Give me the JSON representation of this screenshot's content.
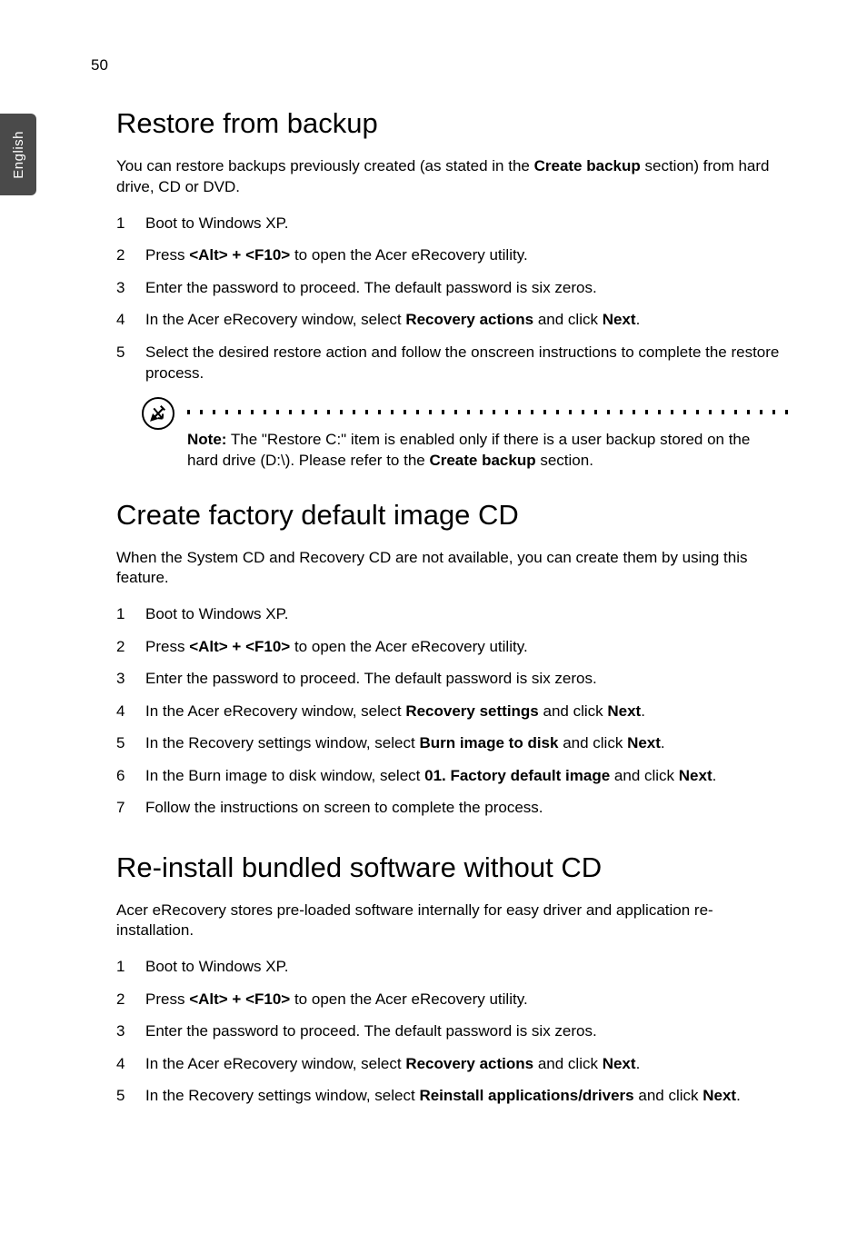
{
  "side_tab": "English",
  "page_number": "50",
  "sections": [
    {
      "title": "Restore from backup",
      "intro_parts": [
        "You can restore backups previously created (as stated in the ",
        "Create backup",
        " section) from hard drive, CD or DVD."
      ],
      "items": [
        {
          "parts": [
            "Boot to Windows XP."
          ]
        },
        {
          "parts": [
            "Press ",
            "<Alt> + <F10>",
            " to open the Acer eRecovery utility."
          ]
        },
        {
          "parts": [
            "Enter the password to proceed. The default password is six zeros."
          ]
        },
        {
          "parts": [
            "In the Acer eRecovery window, select ",
            "Recovery actions",
            " and click ",
            "Next",
            "."
          ]
        },
        {
          "parts": [
            "Select the desired restore action and follow the onscreen instructions to complete the restore process."
          ]
        }
      ],
      "note_parts": [
        "Note:",
        " The \"Restore C:\" item is enabled only if there is a user backup stored on the hard drive (D:\\). Please refer to the ",
        "Create backup",
        " section."
      ]
    },
    {
      "title": "Create factory default image CD",
      "intro_parts": [
        "When the System CD and Recovery CD are not available, you can create them by using this feature."
      ],
      "items": [
        {
          "parts": [
            "Boot to Windows XP."
          ]
        },
        {
          "parts": [
            "Press ",
            "<Alt> + <F10>",
            " to open the Acer eRecovery utility."
          ]
        },
        {
          "parts": [
            "Enter the password to proceed. The default password is six zeros."
          ]
        },
        {
          "parts": [
            "In the Acer eRecovery window, select ",
            "Recovery settings",
            " and click ",
            "Next",
            "."
          ]
        },
        {
          "parts": [
            "In the Recovery settings window, select ",
            "Burn image to disk",
            " and click ",
            "Next",
            "."
          ]
        },
        {
          "parts": [
            "In the Burn image to disk window, select ",
            "01. Factory default image",
            " and click ",
            "Next",
            "."
          ]
        },
        {
          "parts": [
            "Follow the instructions on screen to complete the process."
          ]
        }
      ]
    },
    {
      "title": "Re-install bundled software without CD",
      "intro_parts": [
        "Acer eRecovery stores pre-loaded software internally for easy driver and application re-installation."
      ],
      "items": [
        {
          "parts": [
            "Boot to Windows XP."
          ]
        },
        {
          "parts": [
            "Press ",
            "<Alt> + <F10>",
            " to open the Acer eRecovery utility."
          ]
        },
        {
          "parts": [
            "Enter the password to proceed. The default password is six zeros."
          ]
        },
        {
          "parts": [
            "In the Acer eRecovery window, select ",
            "Recovery actions",
            " and click ",
            "Next",
            "."
          ]
        },
        {
          "parts": [
            "In the Recovery settings window, select ",
            "Reinstall applications/drivers",
            " and click ",
            "Next",
            "."
          ]
        }
      ]
    }
  ]
}
